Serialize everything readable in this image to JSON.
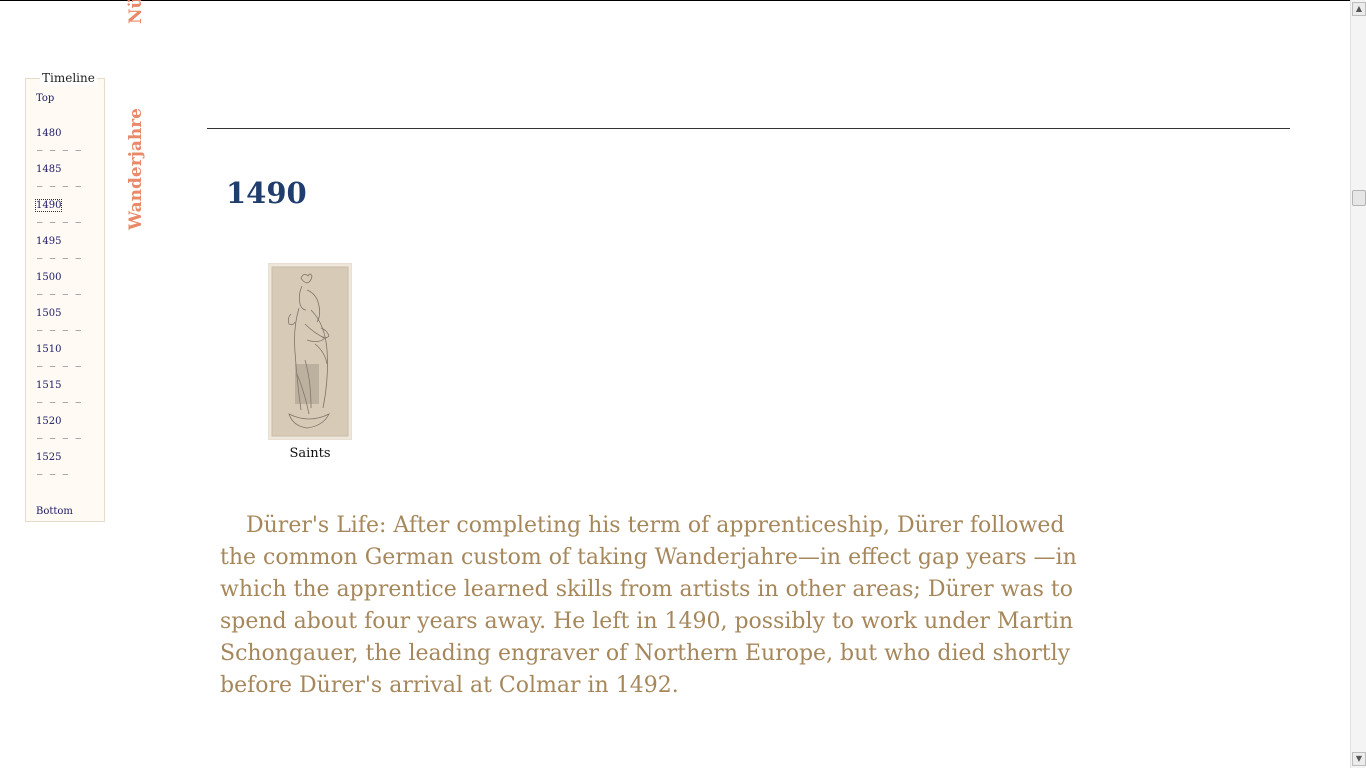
{
  "timeline": {
    "legend": "Timeline",
    "top_label": "Top",
    "years": [
      "1480",
      "1485",
      "1490",
      "1495",
      "1500",
      "1505",
      "1510",
      "1515",
      "1520",
      "1525"
    ],
    "selected_year": "1490",
    "dash_full": "— — — —",
    "dash_short": "— — —",
    "bottom_label": "Bottom"
  },
  "section_labels": {
    "top_partial": "Nü",
    "main": "Wanderjahre"
  },
  "main": {
    "year_heading": "1490",
    "artwork": {
      "caption": "Saints"
    },
    "life_text": "Dürer's Life: After completing his term of apprenticeship, Dürer followed the common German custom of taking Wanderjahre—in effect gap years —in which the apprentice learned skills from artists in other areas; Dürer was to spend about four years away. He left in 1490, possibly to work under Martin Schongauer, the leading engraver of Northern Europe, but who died shortly before Dürer's arrival at Colmar in 1492."
  },
  "scrollbar": {
    "position_fraction": 0.24
  },
  "colors": {
    "accent_label": "#e8896a",
    "year_heading": "#1f3d6d",
    "body_text": "#a6875b",
    "timeline_link": "#1a1a66"
  }
}
